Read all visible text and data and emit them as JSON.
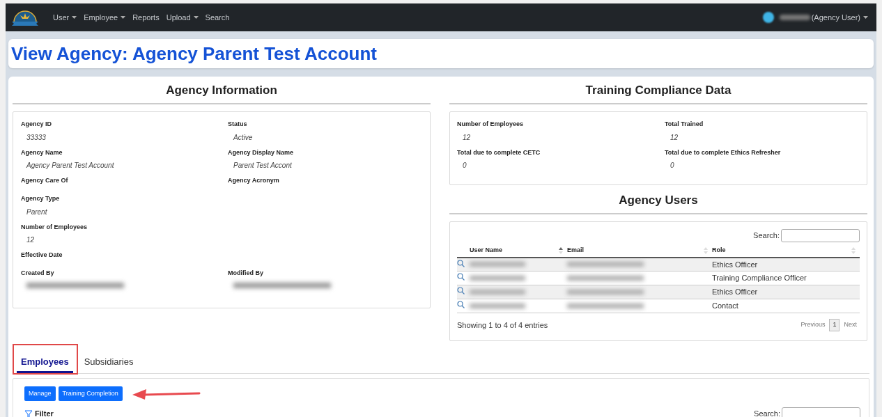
{
  "navbar": {
    "items": [
      {
        "label": "User",
        "dropdown": true
      },
      {
        "label": "Employee",
        "dropdown": true
      },
      {
        "label": "Reports",
        "dropdown": false
      },
      {
        "label": "Upload",
        "dropdown": true
      },
      {
        "label": "Search",
        "dropdown": false
      }
    ],
    "user": {
      "name_blurred": true,
      "label": "(Agency User)",
      "dropdown": true
    }
  },
  "page_title": "View Agency: Agency Parent Test Account",
  "agency_information": {
    "title": "Agency Information",
    "rows": [
      {
        "cells": [
          {
            "label": "Agency ID",
            "value": "33333"
          },
          {
            "label": "Status",
            "value": "Active"
          }
        ]
      },
      {
        "cells": [
          {
            "label": "Agency Name",
            "value": "Agency Parent Test Account"
          },
          {
            "label": "Agency Display Name",
            "value": "Parent Test Accont"
          }
        ]
      },
      {
        "cells": [
          {
            "label": "Agency Care Of"
          },
          {
            "label": "Agency Acronym"
          }
        ]
      },
      {
        "cells": [
          {
            "label": "Agency Type",
            "value": "Parent"
          }
        ]
      },
      {
        "cells": [
          {
            "label": "Number of Employees",
            "value": "12"
          }
        ]
      },
      {
        "cells": [
          {
            "label": "Effective Date"
          }
        ]
      },
      {
        "cells": [
          {
            "label": "Created By",
            "blurred": true
          },
          {
            "label": "Modified By",
            "blurred": true
          }
        ]
      }
    ]
  },
  "training_compliance": {
    "title": "Training Compliance Data",
    "fields": [
      {
        "label": "Number of Employees",
        "value": "12"
      },
      {
        "label": "Total Trained",
        "value": "12"
      },
      {
        "label": "Total due to complete CETC",
        "value": "0"
      },
      {
        "label": "Total due to complete Ethics Refresher",
        "value": "0"
      }
    ]
  },
  "agency_users": {
    "title": "Agency Users",
    "search_label": "Search:",
    "columns": [
      {
        "label": "User Name",
        "sorted": true
      },
      {
        "label": "Email",
        "sorted": false
      },
      {
        "label": "Role",
        "sorted": false
      }
    ],
    "rows": [
      {
        "blurred": true,
        "role": "Ethics Officer"
      },
      {
        "blurred": true,
        "role": "Training Compliance Officer"
      },
      {
        "blurred": true,
        "role": "Ethics Officer"
      },
      {
        "blurred": true,
        "role": "Contact"
      }
    ],
    "info": "Showing 1 to 4 of 4 entries",
    "pagination": {
      "previous": "Previous",
      "pages": [
        {
          "label": "1",
          "selected": true
        }
      ],
      "next": "Next"
    }
  },
  "tabs": [
    {
      "label": "Employees",
      "selected": true,
      "highlighted": true
    },
    {
      "label": "Subsidiaries",
      "selected": false,
      "highlighted": false
    }
  ],
  "employees_panel": {
    "buttons": [
      "Manage",
      "Training Completion"
    ],
    "arrow_annotation": true,
    "filter": "Filter",
    "search_label": "Search:"
  }
}
